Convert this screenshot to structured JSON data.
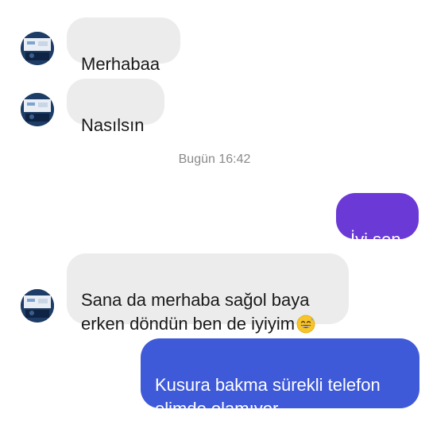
{
  "chat": {
    "incoming_color": "#ececec",
    "outgoing_color_1": "#6b3ad6",
    "outgoing_color_2": "#3f5ad8",
    "timestamp": "Bugün 16:42",
    "messages": [
      {
        "from": "contact",
        "text": "Merhabaa"
      },
      {
        "from": "contact",
        "text": "Nasılsın"
      },
      {
        "from": "me",
        "text": "İyi sen"
      },
      {
        "from": "contact",
        "text": "Sana da merhaba sağol baya\nerken döndün ben de iyiyim",
        "emoji": "grinning-sweat-emoji"
      },
      {
        "from": "me",
        "text": "Kusura bakma sürekli telefon\nelimde olamıyor"
      }
    ]
  }
}
